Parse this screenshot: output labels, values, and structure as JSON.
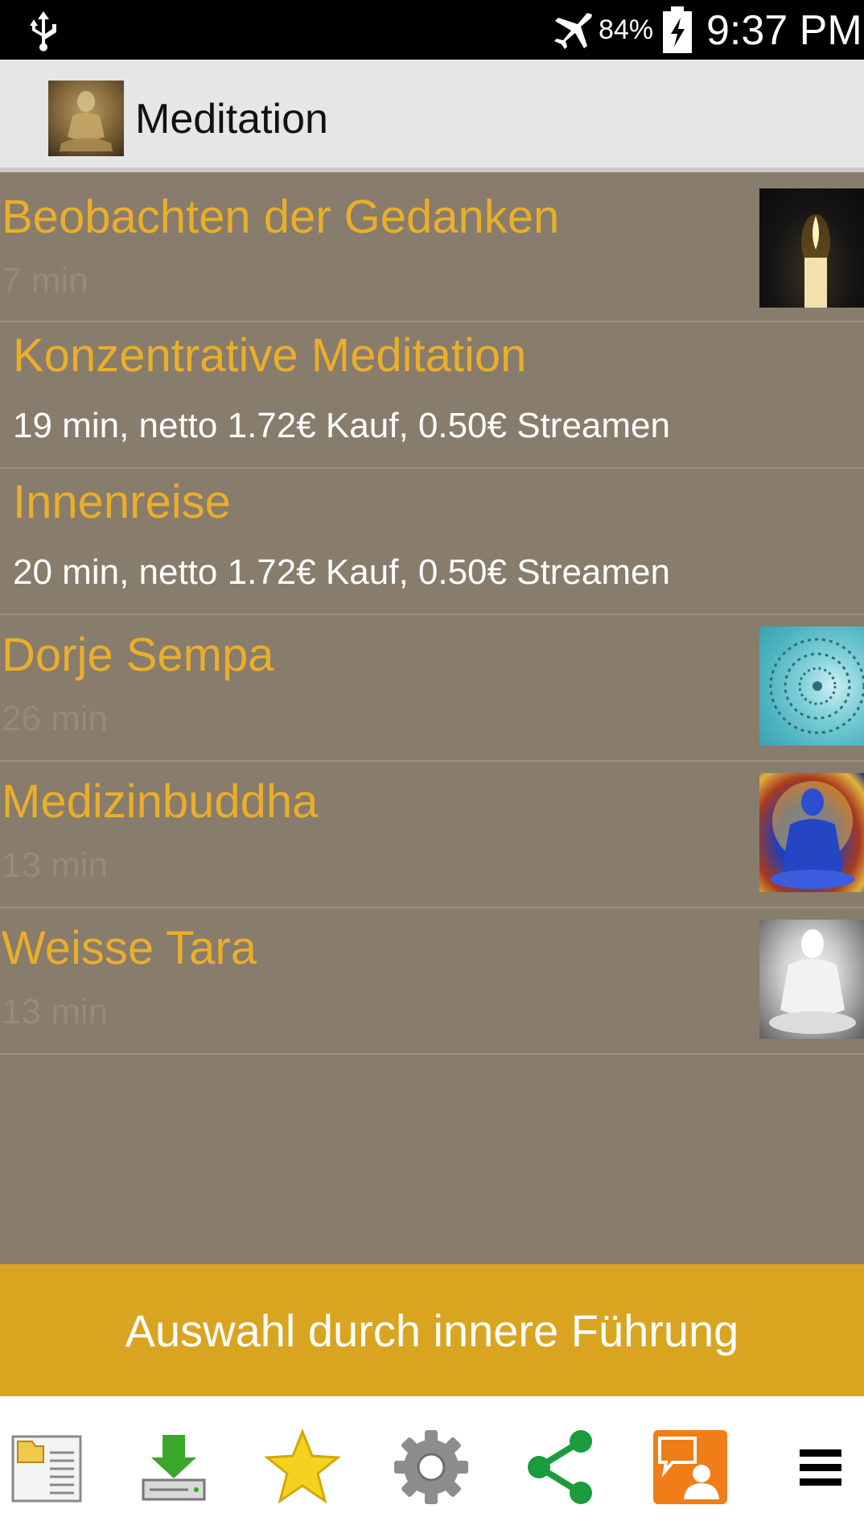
{
  "status_bar": {
    "battery_percent": "84%",
    "time": "9:37 PM",
    "icons": [
      "usb-icon",
      "airplane-mode-icon",
      "battery-charging-icon"
    ]
  },
  "action_bar": {
    "title": "Meditation",
    "app_icon": "buddha-statue-icon"
  },
  "items": [
    {
      "title": "Beobachten der Gedanken",
      "subtitle": "7 min",
      "thumbnail": "candle-image"
    },
    {
      "title": "Konzentrative Meditation",
      "subtitle": "19 min, netto 1.72€ Kauf, 0.50€ Streamen"
    },
    {
      "title": "Innenreise",
      "subtitle": "20 min, netto 1.72€ Kauf, 0.50€ Streamen"
    },
    {
      "title": "Dorje Sempa",
      "subtitle": "26 min",
      "thumbnail": "mantra-mandala-image"
    },
    {
      "title": "Medizinbuddha",
      "subtitle": "13 min",
      "thumbnail": "medicine-buddha-image"
    },
    {
      "title": "Weisse Tara",
      "subtitle": "13 min",
      "thumbnail": "white-tara-image"
    }
  ],
  "guide_button": {
    "label": "Auswahl durch innere Führung"
  },
  "toolbar": {
    "icons": [
      "folder-list-icon",
      "download-icon",
      "star-icon",
      "gear-icon",
      "share-icon",
      "chat-person-icon",
      "menu-icon"
    ]
  },
  "colors": {
    "list_background": "#887c6c",
    "title_color": "#e9ae2a",
    "button_color": "#d9a520"
  }
}
